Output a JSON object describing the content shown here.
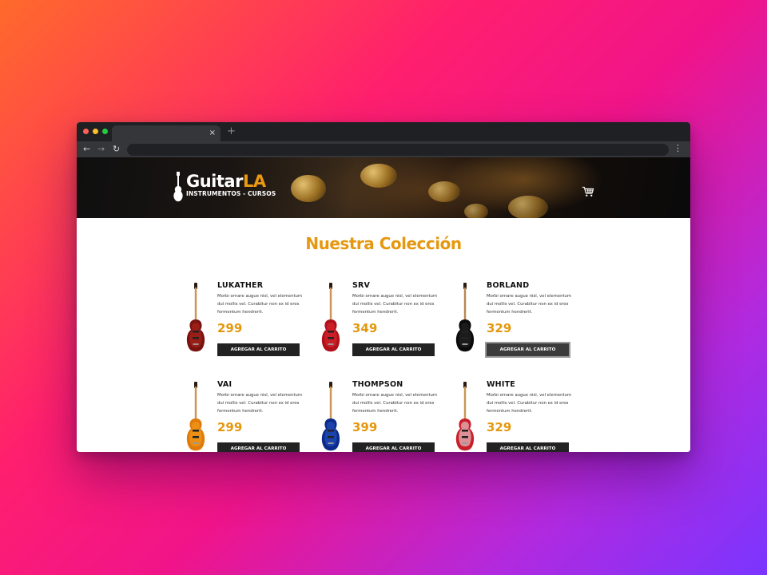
{
  "browser": {
    "tab_close": "×",
    "new_tab": "+",
    "back": "←",
    "forward": "→",
    "reload": "↻",
    "menu": "⋮",
    "dot_colors": [
      "#ff5f57",
      "#febc2e",
      "#28c840"
    ]
  },
  "header": {
    "logo_main": "Guitar",
    "logo_accent": "LA",
    "logo_sub": "INSTRUMENTOS - CURSOS",
    "cart_icon": "cart-icon"
  },
  "collection": {
    "title": "Nuestra Colección",
    "products": [
      {
        "name": "LUKATHER",
        "price": "299",
        "description": "Morbi ornare augue nisl, vel elementum dui mollis vel. Curabitur non ex id eros fermentum hendrerit.",
        "button": "AGREGAR AL CARRITO",
        "body_color": "#7a1210",
        "body_color2": "#b3281c"
      },
      {
        "name": "SRV",
        "price": "349",
        "description": "Morbi ornare augue nisl, vel elementum dui mollis vel. Curabitur non ex id eros fermentum hendrerit.",
        "button": "AGREGAR AL CARRITO",
        "body_color": "#b0101a",
        "body_color2": "#e02b33"
      },
      {
        "name": "BORLAND",
        "price": "329",
        "description": "Morbi ornare augue nisl, vel elementum dui mollis vel. Curabitur non ex id eros fermentum hendrerit.",
        "button": "AGREGAR AL CARRITO",
        "body_color": "#0b0b0b",
        "body_color2": "#2a2a2a"
      },
      {
        "name": "VAI",
        "price": "299",
        "description": "Morbi ornare augue nisl, vel elementum dui mollis vel. Curabitur non ex id eros fermentum hendrerit.",
        "button": "AGREGAR AL CARRITO",
        "body_color": "#e07a08",
        "body_color2": "#f5a020"
      },
      {
        "name": "THOMPSON",
        "price": "399",
        "description": "Morbi ornare augue nisl, vel elementum dui mollis vel. Curabitur non ex id eros fermentum hendrerit.",
        "button": "AGREGAR AL CARRITO",
        "body_color": "#0b2a8a",
        "body_color2": "#2c57c8"
      },
      {
        "name": "WHITE",
        "price": "329",
        "description": "Morbi ornare augue nisl, vel elementum dui mollis vel. Curabitur non ex id eros fermentum hendrerit.",
        "button": "AGREGAR AL CARRITO",
        "body_color": "#c8202a",
        "body_color2": "#eeeeee"
      }
    ]
  },
  "colors": {
    "accent": "#e5980f",
    "button": "#222222"
  }
}
